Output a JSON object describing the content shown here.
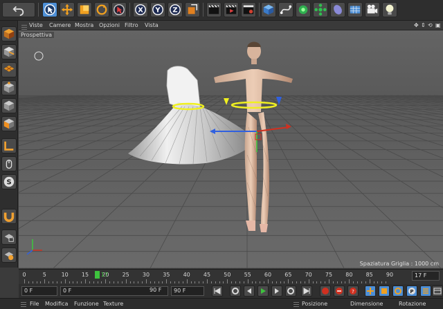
{
  "colors": {
    "panel": "#2e2e2e",
    "viewport_bg": "#5f5f5f",
    "accent_blue": "#4d8fd6",
    "playhead_green": "#3ec23e",
    "axis_x": "#d03020",
    "axis_y": "#3cc83c",
    "axis_z": "#3060e0"
  },
  "top_toolbar": {
    "buttons": [
      "undo-icon",
      "live-select-icon",
      "move-icon",
      "scale-icon",
      "rotate-icon",
      "recent-tool-icon",
      "x-axis-icon",
      "y-axis-icon",
      "z-axis-icon",
      "coordinate-system-icon",
      "render-view-icon",
      "render-picture-icon",
      "render-settings-icon",
      "cube-primitive-icon",
      "spline-icon",
      "nurbs-icon",
      "array-icon",
      "deformer-icon",
      "floor-icon",
      "camera-icon",
      "light-icon"
    ],
    "axis_labels": [
      "X",
      "Y",
      "Z"
    ]
  },
  "viewport": {
    "menu": [
      "Viste",
      "Camere",
      "Mostra",
      "Opzioni",
      "Filtro",
      "Vista"
    ],
    "view_name": "Prospettiva",
    "grid_spacing": "Spaziatura Griglia : 1000 cm",
    "nav_icons": [
      "✥",
      "⇕",
      "⟲",
      "▣"
    ]
  },
  "left_toolbar": {
    "buttons": [
      "model-mode-icon",
      "object-mode-icon",
      "texture-mode-icon",
      "points-mode-icon",
      "edges-mode-icon",
      "polygons-mode-icon",
      "workplane-icon",
      "tweak-icon",
      "snap-icon",
      "magnet-icon",
      "lock-icon",
      "solo-icon"
    ]
  },
  "timeline": {
    "ticks": [
      "0",
      "5",
      "10",
      "15",
      "20",
      "25",
      "30",
      "35",
      "40",
      "45",
      "50",
      "55",
      "60",
      "65",
      "70",
      "75",
      "80",
      "85",
      "90"
    ],
    "current_marker": "17",
    "current_frame": "17 F"
  },
  "transport": {
    "start_field": "0 F",
    "min_field": "0 F",
    "max_field": "90 F",
    "end_field": "90 F"
  },
  "bottom_bar": {
    "left_menu": [
      "File",
      "Modifica",
      "Funzione",
      "Texture"
    ],
    "right_headers": [
      "Posizione",
      "Dimensione",
      "Rotazione"
    ]
  }
}
